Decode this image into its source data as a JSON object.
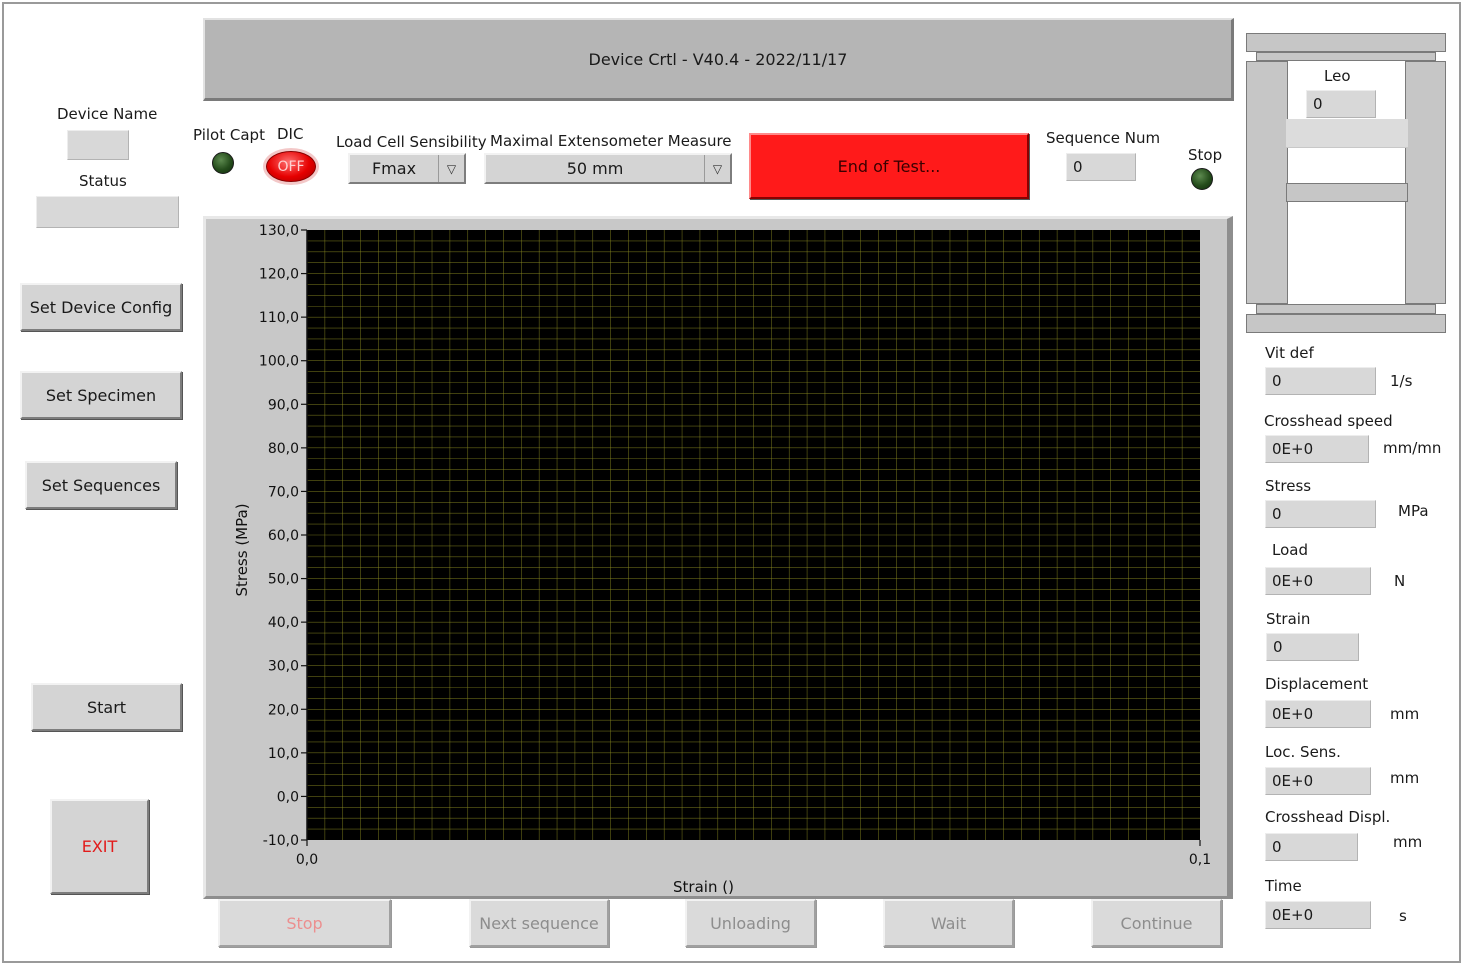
{
  "header": {
    "title": "Device Crtl - V40.4 - 2022/11/17"
  },
  "left_panel": {
    "device_name_label": "Device Name",
    "device_name_value": "",
    "status_label": "Status",
    "status_value": "",
    "buttons": {
      "set_device_config": "Set Device Config",
      "set_specimen": "Set  Specimen",
      "set_sequences": "Set Sequences",
      "start": "Start",
      "exit": "EXIT"
    }
  },
  "top_controls": {
    "pilot_capt_label": "Pilot Capt",
    "dic_label": "DIC",
    "dic_toggle": "OFF",
    "load_cell_label": "Load Cell Sensibility",
    "load_cell_value": "Fmax",
    "extensometer_label": "Maximal Extensometer Measure",
    "extensometer_value": "50 mm",
    "end_of_test_button": "End of Test...",
    "sequence_num_label": "Sequence Num",
    "sequence_num_value": "0",
    "stop_label": "Stop",
    "colors": {
      "end_of_test": "#ff1a1a",
      "dic_toggle": "#e60000",
      "led": "#2f5a24"
    }
  },
  "chart_data": {
    "type": "line",
    "xlabel": "Strain ()",
    "ylabel": "Stress (MPa)",
    "xlim": [
      0.0,
      0.1
    ],
    "ylim": [
      -10.0,
      130.0
    ],
    "x_ticks": [
      "0,0",
      "0,1"
    ],
    "y_ticks": [
      "130,0",
      "120,0",
      "110,0",
      "100,0",
      "90,0",
      "80,0",
      "70,0",
      "60,0",
      "50,0",
      "40,0",
      "30,0",
      "20,0",
      "10,0",
      "0,0",
      "-10,0"
    ],
    "series": [],
    "grid": true,
    "background": "#000000",
    "grid_color": "#8a8a22"
  },
  "bottom_buttons": {
    "stop": "Stop",
    "next_sequence": "Next sequence",
    "unloading": "Unloading",
    "wait": "Wait",
    "continue": "Continue"
  },
  "right_panel": {
    "leo_label": "Leo",
    "leo_value": "0",
    "fields": [
      {
        "label": "Vit def",
        "value": "0",
        "unit": "1/s"
      },
      {
        "label": "Crosshead speed",
        "value": "0E+0",
        "unit": "mm/mn"
      },
      {
        "label": "Stress",
        "value": "0",
        "unit": "MPa"
      },
      {
        "label": "Load",
        "value": "0E+0",
        "unit": "N"
      },
      {
        "label": "Strain",
        "value": "0",
        "unit": ""
      },
      {
        "label": "Displacement",
        "value": "0E+0",
        "unit": "mm"
      },
      {
        "label": "Loc. Sens.",
        "value": "0E+0",
        "unit": "mm"
      },
      {
        "label": "Crosshead Displ.",
        "value": "0",
        "unit": "mm"
      },
      {
        "label": "Time",
        "value": "0E+0",
        "unit": "s"
      }
    ]
  }
}
